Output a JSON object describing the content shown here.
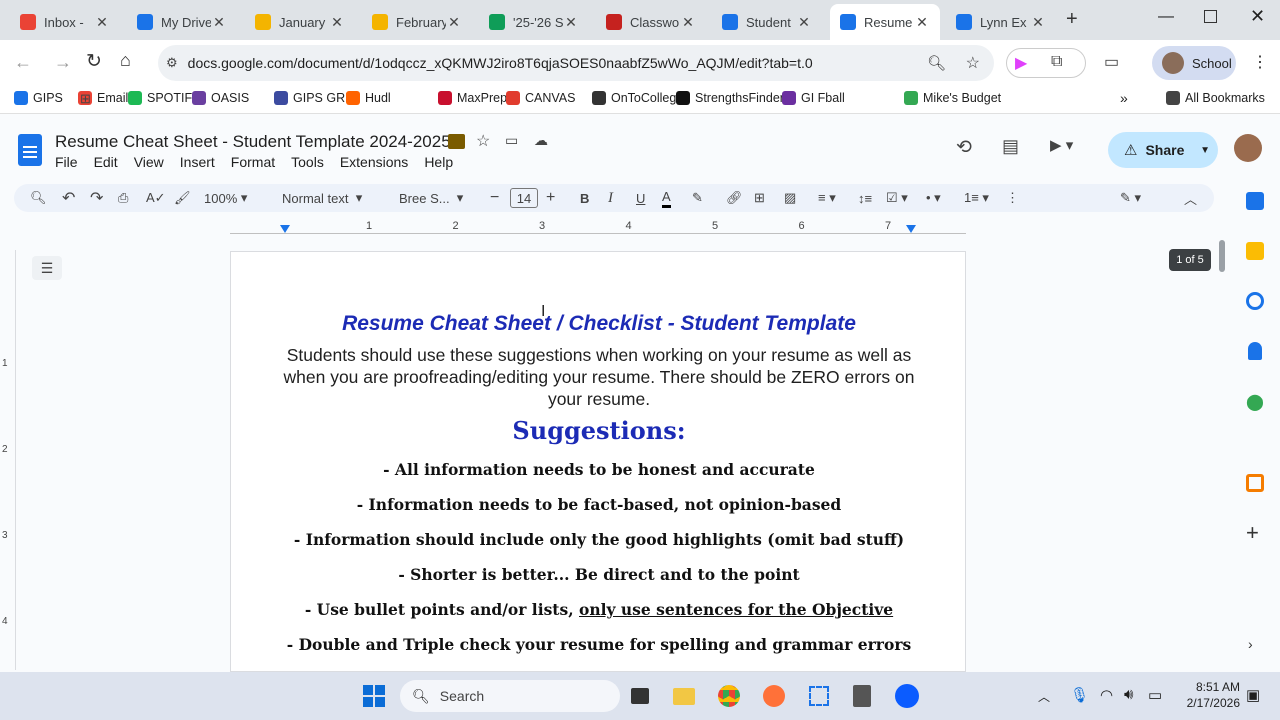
{
  "tabs": [
    {
      "title": "Inbox -",
      "icon": "gmail-icon",
      "color": "#ea4335"
    },
    {
      "title": "My Drive",
      "icon": "drive-icon",
      "color": "#1a73e8"
    },
    {
      "title": "January",
      "icon": "slides-icon",
      "color": "#f4b400"
    },
    {
      "title": "February",
      "icon": "slides-icon",
      "color": "#f4b400"
    },
    {
      "title": "'25-'26 S",
      "icon": "sheets-icon",
      "color": "#0f9d58"
    },
    {
      "title": "Classwo",
      "icon": "classroom-icon",
      "color": "#c5221f"
    },
    {
      "title": "Student",
      "icon": "docs-icon",
      "color": "#1a73e8"
    },
    {
      "title": "Resume",
      "icon": "docs-icon",
      "color": "#1a73e8"
    },
    {
      "title": "Lynn Ex",
      "icon": "drive-icon",
      "color": "#1a73e8"
    }
  ],
  "address": {
    "url": "docs.google.com/document/d/1odqccz_xQKMWJ2iro8T6qjaSOES0naabfZ5wWo_AQJM/edit?tab=t.0"
  },
  "profile": {
    "label": "School"
  },
  "bookmarks": [
    {
      "label": "GIPS",
      "color": "#1a73e8"
    },
    {
      "label": "Email",
      "color": "#ea4335"
    },
    {
      "label": "SPOTIFY",
      "color": "#1db954"
    },
    {
      "label": "OASIS",
      "color": "#6a3fa0"
    },
    {
      "label": "GIPS GRID",
      "color": "#3c4ba0"
    },
    {
      "label": "Hudl",
      "color": "#ff6300"
    },
    {
      "label": "MaxPreps",
      "color": "#c8102e"
    },
    {
      "label": "CANVAS",
      "color": "#e13c2e"
    },
    {
      "label": "OnToCollege",
      "color": "#333333"
    },
    {
      "label": "StrengthsFinder",
      "color": "#111111"
    },
    {
      "label": "GI Fball",
      "color": "#6b2fa0"
    },
    {
      "label": "Mike's Budget",
      "color": "#34a853"
    },
    {
      "label": "All Bookmarks",
      "color": "#444444"
    }
  ],
  "doc": {
    "title": "Resume Cheat Sheet - Student Template 2024-2025",
    "menu": [
      "File",
      "Edit",
      "View",
      "Insert",
      "Format",
      "Tools",
      "Extensions",
      "Help"
    ],
    "share_label": "Share",
    "page_indicator": "1 of 5"
  },
  "toolbar": {
    "zoom": "100%",
    "style": "Normal text",
    "font": "Bree S...",
    "font_size": "14"
  },
  "ruler": [
    "1",
    "2",
    "3",
    "4",
    "5",
    "6",
    "7"
  ],
  "vruler": [
    "1",
    "2",
    "3",
    "4"
  ],
  "content": {
    "title": "Resume Cheat Sheet / Checklist - Student Template",
    "intro": "Students should use these suggestions when working on your resume as well as when you are proofreading/editing your resume. There should be ZERO errors on your resume.",
    "heading": "Suggestions:",
    "items": [
      "- All information needs to be honest and accurate",
      "- Information needs to be fact-based, not opinion-based",
      "- Information should include only the good highlights (omit bad stuff)",
      "- Shorter is better... Be direct and to the point",
      "- Use bullet points and/or lists, ",
      "- Double and Triple check your resume for spelling and grammar errors"
    ],
    "item5_underlined": "only use sentences for the Objective"
  },
  "taskbar": {
    "search": "Search",
    "time": "8:51 AM",
    "date": "2/17/2026"
  }
}
